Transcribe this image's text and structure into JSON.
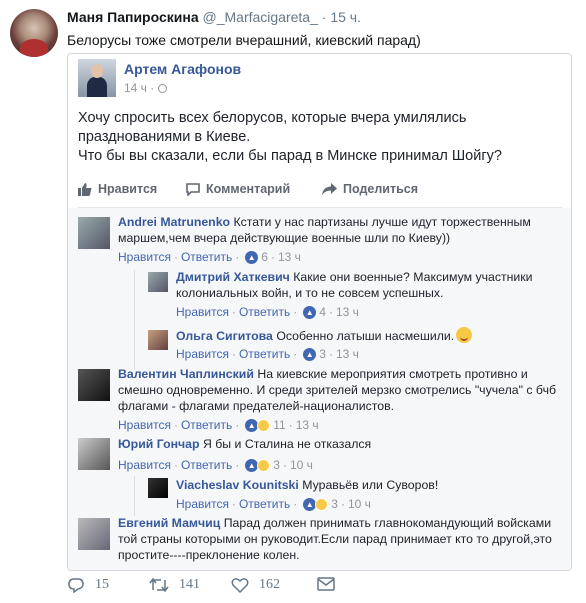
{
  "tweet": {
    "author_name": "Маня Папироскина",
    "author_handle": "@_Marfacigareta_",
    "time": "· 15 ч.",
    "text": "Белорусы тоже смотрели вчерашний, киевский парад)",
    "reply_count": "15",
    "retweet_count": "141",
    "like_count": "162"
  },
  "fb_post": {
    "author": "Артем Агафонов",
    "time": "14 ч ·",
    "lines": [
      "Хочу спросить всех белорусов, которые вчера умилялись празднованиями в Киеве.",
      "Что бы вы сказали, если бы парад в Минске принимал Шойгу?"
    ],
    "actions": {
      "like": "Нравится",
      "comment": "Комментарий",
      "share": "Поделиться"
    }
  },
  "comments": [
    {
      "name": "Andrei Matrunenko",
      "text": "Кстати у нас партизаны лучше идут торжественным маршем,чем вчера действующие военные шли по Киеву))",
      "like": "Нравится",
      "reply": "Ответить",
      "likes": "6",
      "time": "13 ч"
    },
    {
      "name": "Дмитрий Хаткевич",
      "text": "Какие они военные? Максимум участники колониальных войн, и то не совсем успешных.",
      "like": "Нравится",
      "reply": "Ответить",
      "likes": "4",
      "time": "13 ч"
    },
    {
      "name": "Ольга Сигитова",
      "text": "Особенно латыши насмешили.",
      "like": "Нравится",
      "reply": "Ответить",
      "likes": "3",
      "time": "13 ч"
    },
    {
      "name": "Валентин Чаплинский",
      "text": "На киевские мероприятия смотреть противно и смешно одновременно. И среди зрителей мерзко смотрелись \"чучела\" с бчб флагами - флагами предателей-националистов.",
      "like": "Нравится",
      "reply": "Ответить",
      "likes": "11",
      "time": "13 ч"
    },
    {
      "name": "Юрий Гончар",
      "text": "Я бы и Сталина не отказался",
      "like": "Нравится",
      "reply": "Ответить",
      "likes": "3",
      "time": "10 ч"
    },
    {
      "name": "Viacheslav Kounitski",
      "text": "Муравьёв или Суворов!",
      "like": "Нравится",
      "reply": "Ответить",
      "likes": "3",
      "time": "10 ч"
    },
    {
      "name": "Евгений Мамчиц",
      "text": "Парад должен принимать главнокомандующий войсками той страны которыми он руководит.Если парад принимает кто то другой,это простите----преклонение колен.",
      "like": "",
      "reply": "",
      "likes": "",
      "time": ""
    }
  ],
  "colors": {
    "fb_link": "#365899",
    "fb_blue": "#4267b2",
    "muted": "#90949c",
    "twitter_muted": "#657786"
  }
}
